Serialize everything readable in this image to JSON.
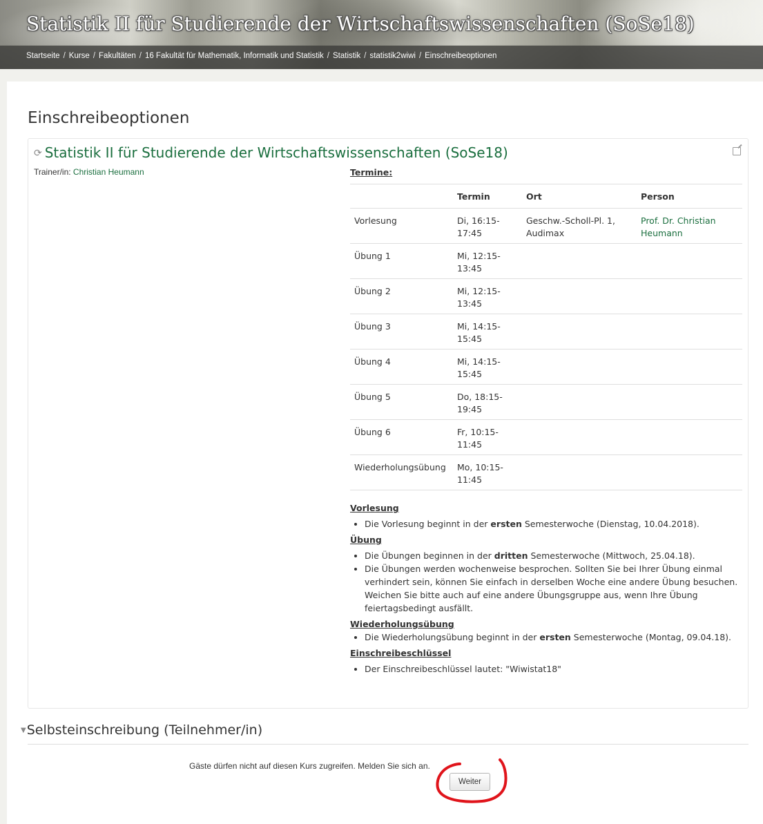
{
  "header": {
    "site_title": "Statistik II für Studierende der Wirtschaftswissenschaften (SoSe18)",
    "breadcrumb": [
      "Startseite",
      "Kurse",
      "Fakultäten",
      "16 Fakultät für Mathematik, Informatik und Statistik",
      "Statistik",
      "statistik2wiwi",
      "Einschreibeoptionen"
    ],
    "breadcrumb_separator": "/"
  },
  "page": {
    "heading": "Einschreibeoptionen"
  },
  "course": {
    "title": "Statistik II für Studierende der Wirtschaftswissenschaften (SoSe18)",
    "title_icon": "course-icon",
    "edit_icon": "edit-icon",
    "teacher_label": "Trainer/in:",
    "teacher_name": "Christian Heumann",
    "termine_heading": "Termine:",
    "schedule": {
      "headers": [
        "",
        "Termin",
        "Ort",
        "Person"
      ],
      "rows": [
        [
          "Vorlesung",
          "Di, 16:15-\n17:45",
          "Geschw.-Scholl-Pl. 1,\nAudimax",
          "Prof. Dr. Christian\nHeumann"
        ],
        [
          "Übung 1",
          "Mi, 12:15-\n13:45",
          "",
          ""
        ],
        [
          "Übung 2",
          "Mi, 12:15-\n13:45",
          "",
          ""
        ],
        [
          "Übung 3",
          "Mi, 14:15-\n15:45",
          "",
          ""
        ],
        [
          "Übung 4",
          "Mi, 14:15-\n15:45",
          "",
          ""
        ],
        [
          "Übung 5",
          "Do, 18:15-\n19:45",
          "",
          ""
        ],
        [
          "Übung 6",
          "Fr, 10:15-\n11:45",
          "",
          ""
        ],
        [
          "Wiederholungsübung",
          "Mo, 10:15-\n11:45",
          "",
          ""
        ]
      ]
    },
    "notes": {
      "vorlesung_heading": "Vorlesung",
      "vorlesung_1": {
        "pre": "Die Vorlesung beginnt in der ",
        "bold": "ersten",
        "post": " Semesterwoche (Dienstag, 10.04.2018)."
      },
      "uebung_heading": "Übung",
      "uebung_1": {
        "pre": "Die Übungen beginnen in der ",
        "bold": "dritten",
        "post": " Semesterwoche (Mittwoch, 25.04.18)."
      },
      "uebung_2": "Die Übungen werden wochenweise besprochen. Sollten Sie bei Ihrer Übung einmal verhindert sein, können Sie einfach in derselben Woche eine andere Übung besuchen. Weichen Sie bitte auch auf eine andere Übungsgruppe aus, wenn Ihre Übung feiertagsbedingt ausfällt.",
      "wiederholung_heading": "Wiederholungsübung",
      "wiederholung_1": {
        "pre": "Die Wiederholungsübung beginnt in der ",
        "bold": "ersten",
        "post": " Semesterwoche (Montag, 09.04.18)."
      },
      "schluessel_heading": "Einschreibeschlüssel",
      "schluessel_1": "Der Einschreibeschlüssel lautet: \"Wiwistat18\""
    }
  },
  "self_enrolment": {
    "heading": "Selbsteinschreibung (Teilnehmer/in)",
    "guest_message": "Gäste dürfen nicht auf diesen Kurs zugreifen. Melden Sie sich an.",
    "continue_label": "Weiter",
    "annotation_color": "#e0141b"
  },
  "colors": {
    "link": "#1a6e3e",
    "text": "#333333",
    "annotation": "#e0141b"
  }
}
